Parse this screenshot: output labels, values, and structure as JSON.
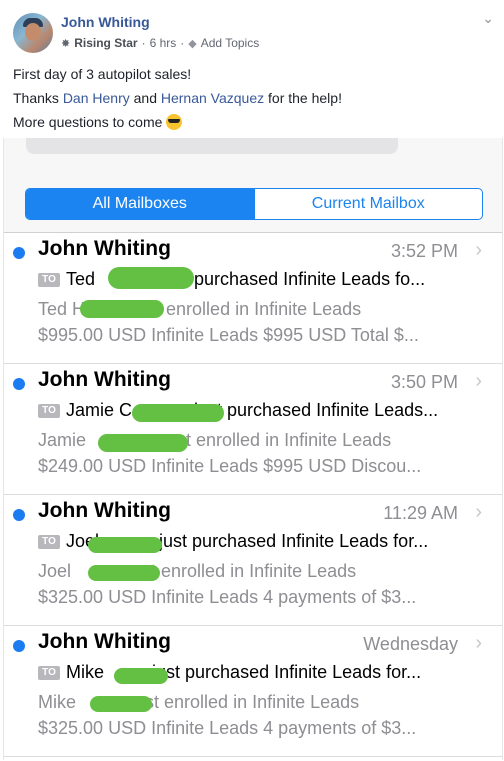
{
  "post": {
    "author": "John Whiting",
    "badge": "Rising Star",
    "time": "6 hrs",
    "separator": "·",
    "add_topics": "Add Topics",
    "line1": "First day of 3 autopilot sales!",
    "line2_pre": "Thanks ",
    "line2_link1": "Dan Henry",
    "line2_mid": " and ",
    "line2_link2": "Hernan Vazquez",
    "line2_post": " for the help!",
    "line3": "More questions to come "
  },
  "mail": {
    "tabs": [
      "All Mailboxes",
      "Current Mailbox"
    ],
    "to_badge": "TO",
    "messages": [
      {
        "sender": "John Whiting",
        "time": "3:52 PM",
        "subject_a": "Ted ",
        "subject_b": "st purchased Infinite Leads fo...",
        "preview1_a": "Ted H",
        "preview1_b": "st enrolled in Infinite Leads",
        "preview2": "$995.00 USD Infinite Leads $995 USD Total $..."
      },
      {
        "sender": "John Whiting",
        "time": "3:50 PM",
        "subject_a": "Jamie C",
        "subject_b": "just purchased Infinite Leads...",
        "preview1_a": "Jamie ",
        "preview1_b": "st enrolled in Infinite Leads",
        "preview2": "$249.00 USD Infinite Leads $995 USD Discou..."
      },
      {
        "sender": "John Whiting",
        "time": "11:29 AM",
        "subject_a": "Joel ",
        "subject_b": "just purchased Infinite Leads for...",
        "preview1_a": "Joel ",
        "preview1_b": "st enrolled in Infinite Leads",
        "preview2": "$325.00 USD Infinite Leads 4 payments of $3..."
      },
      {
        "sender": "John Whiting",
        "time": "Wednesday",
        "subject_a": "Mike ",
        "subject_b": "just purchased Infinite Leads for...",
        "preview1_a": "Mike ",
        "preview1_b": "st enrolled in Infinite Leads",
        "preview2": "$325.00 USD Infinite Leads 4 payments of $3..."
      }
    ]
  },
  "colors": {
    "accent": "#1b84f0",
    "unread_dot": "#1b7cf2",
    "redaction": "#64c043",
    "link": "#385898"
  }
}
